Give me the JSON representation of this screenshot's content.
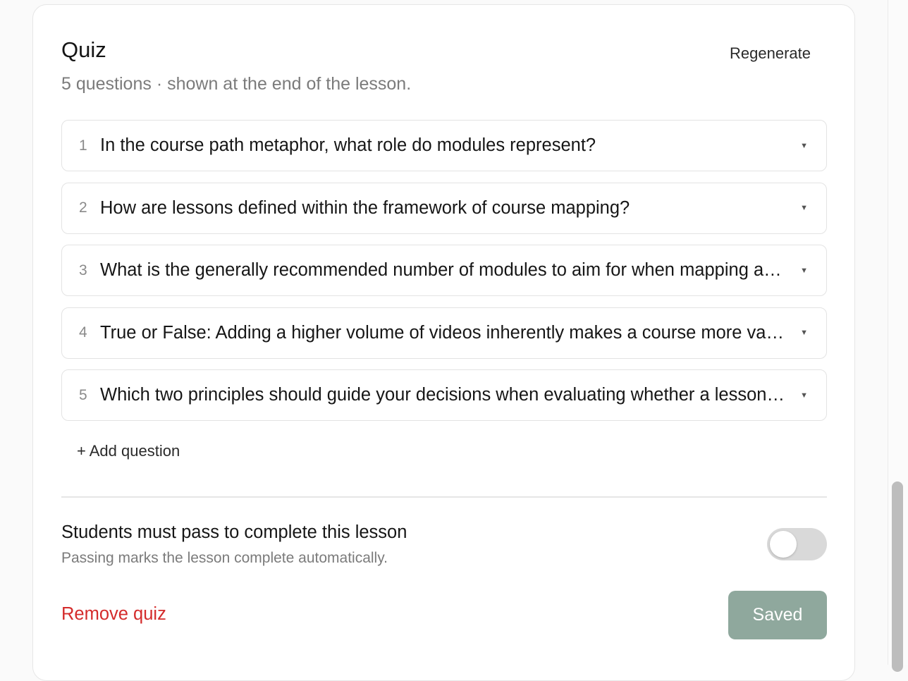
{
  "quiz": {
    "title": "Quiz",
    "regenerate_label": "Regenerate",
    "subtitle": "5 questions · shown at the end of the lesson.",
    "questions": [
      {
        "num": "1",
        "text": "In the course path metaphor, what role do modules represent?"
      },
      {
        "num": "2",
        "text": "How are lessons defined within the framework of course mapping?"
      },
      {
        "num": "3",
        "text": "What is the generally recommended number of modules to aim for when mapping a course?"
      },
      {
        "num": "4",
        "text": "True or False: Adding a higher volume of videos inherently makes a course more valuable."
      },
      {
        "num": "5",
        "text": "Which two principles should guide your decisions when evaluating whether a lesson belongs?"
      }
    ],
    "caret": "▼",
    "add_question_label": "+ Add question",
    "pass_requirement": {
      "title": "Students must pass to complete this lesson",
      "subtitle": "Passing marks the lesson complete automatically.",
      "enabled": false
    },
    "remove_label": "Remove quiz",
    "saved_label": "Saved"
  },
  "colors": {
    "danger": "#d42b2b",
    "saved_button": "#8fa89d",
    "toggle_off": "#d9d9d9"
  }
}
